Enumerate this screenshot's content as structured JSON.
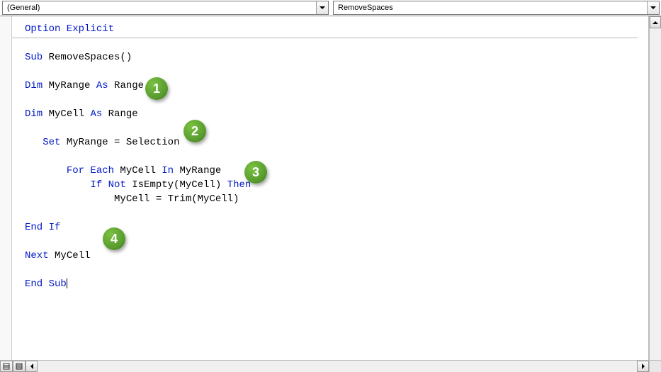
{
  "dropdowns": {
    "object": "(General)",
    "procedure": "RemoveSpaces"
  },
  "code": {
    "l1a": "Option Explicit",
    "l2a": "Sub",
    "l2b": " RemoveSpaces()",
    "l3a": "Dim",
    "l3b": " MyRange ",
    "l3c": "As",
    "l3d": " Range",
    "l4a": "Dim",
    "l4b": " MyCell ",
    "l4c": "As",
    "l4d": " Range",
    "l5a": "   ",
    "l5b": "Set",
    "l5c": " MyRange = Selection",
    "l6a": "       ",
    "l6b": "For Each",
    "l6c": " MyCell ",
    "l6d": "In",
    "l6e": " MyRange",
    "l7a": "           ",
    "l7b": "If Not",
    "l7c": " IsEmpty(MyCell) ",
    "l7d": "Then",
    "l8a": "               MyCell = Trim(MyCell)",
    "l9a": "End If",
    "l10a": "Next",
    "l10b": " MyCell",
    "l11a": "End Sub"
  },
  "callouts": {
    "c1": "1",
    "c2": "2",
    "c3": "3",
    "c4": "4"
  }
}
